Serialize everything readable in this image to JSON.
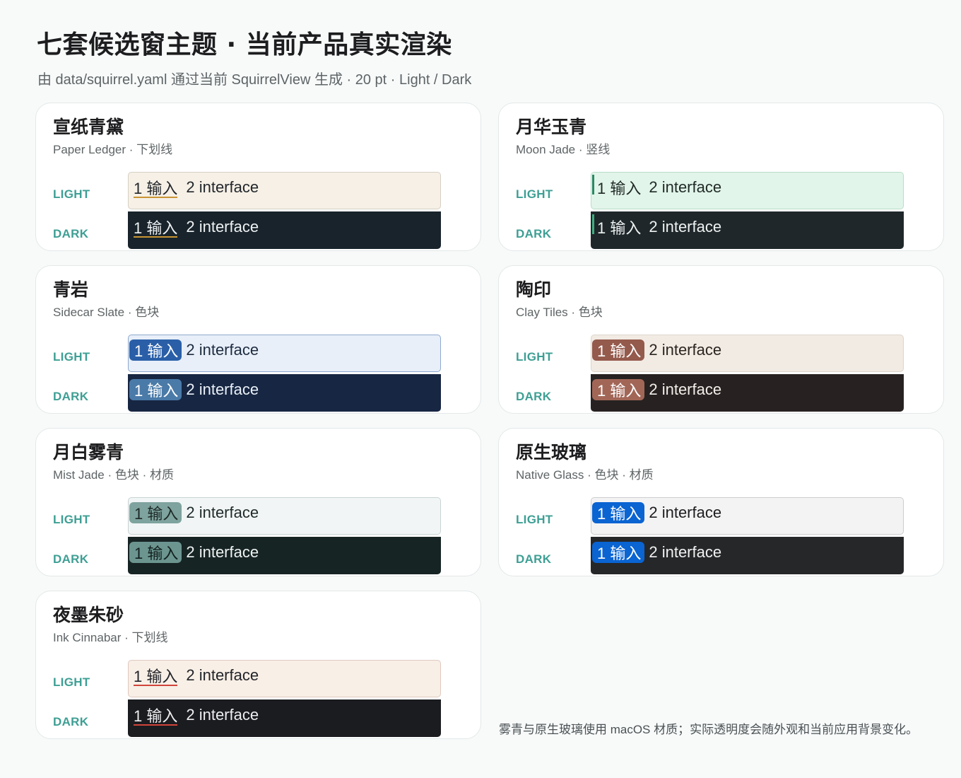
{
  "header": {
    "title": "七套候选窗主题 · 当前产品真实渲染",
    "subtitle": "由 data/squirrel.yaml 通过当前 SquirrelView 生成 · 20 pt · Light / Dark"
  },
  "labels": {
    "light": "LIGHT",
    "dark": "DARK"
  },
  "candidates": {
    "first": "1 输入",
    "second": "2 interface"
  },
  "footnote": "雾青与原生玻璃使用 macOS 材质；实际透明度会随外观和当前应用背景变化。",
  "themes": [
    {
      "name": "宣纸青黛",
      "subtitle": "Paper Ledger · 下划线",
      "style": "underline",
      "light": {
        "bg": "#f6f0e6",
        "border": "#d6cfc4",
        "text": "#22262b",
        "accent": "#c89434"
      },
      "dark": {
        "bg": "#18232b",
        "border": "#18232b",
        "text": "#eef1f3",
        "accent": "#c89434"
      }
    },
    {
      "name": "月华玉青",
      "subtitle": "Moon Jade · 竖线",
      "style": "bar",
      "light": {
        "bg": "#e2f5ea",
        "border": "#b9dcc8",
        "text": "#1f2a26",
        "accent": "#2a8a62"
      },
      "dark": {
        "bg": "#1f272a",
        "border": "#1f272a",
        "text": "#eef2f1",
        "accent": "#3fae80"
      }
    },
    {
      "name": "青岩",
      "subtitle": "Sidecar Slate · 色块",
      "style": "block",
      "light": {
        "bg": "#e8eff9",
        "border": "#8ea9cf",
        "text": "#1e2c40",
        "accent": "#2a5fa8",
        "accentText": "#ffffff"
      },
      "dark": {
        "bg": "#172642",
        "border": "#172642",
        "text": "#eaf0f8",
        "accent": "#4a7aa8",
        "accentText": "#ffffff"
      }
    },
    {
      "name": "陶印",
      "subtitle": "Clay Tiles · 色块",
      "style": "block",
      "light": {
        "bg": "#f1ebe4",
        "border": "#ddd5cc",
        "text": "#2b2420",
        "accent": "#945a4c",
        "accentText": "#ffffff"
      },
      "dark": {
        "bg": "#272221",
        "border": "#272221",
        "text": "#f3eeea",
        "accent": "#a26657",
        "accentText": "#ffffff"
      }
    },
    {
      "name": "月白雾青",
      "subtitle": "Mist Jade · 色块 · 材质",
      "style": "block",
      "light": {
        "bg": "#f1f5f5",
        "border": "#c9d2d2",
        "text": "#1f2a2a",
        "accent": "#7fa39e",
        "accentText": "#1d2a28"
      },
      "dark": {
        "bg": "#172424",
        "border": "#172424",
        "text": "#eef3f2",
        "accent": "#6c9590",
        "accentText": "#12201e"
      }
    },
    {
      "name": "原生玻璃",
      "subtitle": "Native Glass · 色块 · 材质",
      "style": "block",
      "light": {
        "bg": "#f3f3f4",
        "border": "#cdcdd0",
        "text": "#1d1d1f",
        "accent": "#0a64d2",
        "accentText": "#ffffff"
      },
      "dark": {
        "bg": "#262728",
        "border": "#262728",
        "text": "#f2f2f3",
        "accent": "#0a64d2",
        "accentText": "#ffffff"
      }
    },
    {
      "name": "夜墨朱砂",
      "subtitle": "Ink Cinnabar · 下划线",
      "style": "underline",
      "light": {
        "bg": "#f8efe6",
        "border": "#e0c9c0",
        "text": "#22242a",
        "accent": "#d0443a"
      },
      "dark": {
        "bg": "#1b1c20",
        "border": "#1b1c20",
        "text": "#eeeef0",
        "accent": "#d0443a"
      }
    }
  ]
}
